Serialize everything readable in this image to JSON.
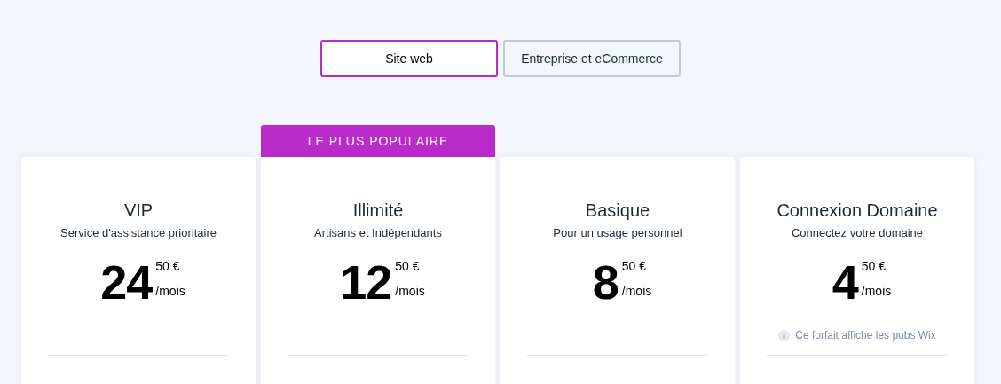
{
  "tabs": [
    {
      "label": "Site web",
      "selected": true
    },
    {
      "label": "Entreprise et eCommerce",
      "selected": false
    }
  ],
  "plans": [
    {
      "name": "VIP",
      "subtitle": "Service d'assistance prioritaire",
      "price": "24",
      "cents": "50 €",
      "period": "/mois",
      "popular": false
    },
    {
      "name": "Illimité",
      "subtitle": "Artisans et Indépendants",
      "price": "12",
      "cents": "50 €",
      "period": "/mois",
      "popular": true,
      "badge": "LE PLUS POPULAIRE"
    },
    {
      "name": "Basique",
      "subtitle": "Pour un usage personnel",
      "price": "8",
      "cents": "50 €",
      "period": "/mois",
      "popular": false
    },
    {
      "name": "Connexion Domaine",
      "subtitle": "Connectez votre domaine",
      "price": "4",
      "cents": "50 €",
      "period": "/mois",
      "popular": false,
      "note": "Ce forfait affiche les pubs Wix"
    }
  ]
}
